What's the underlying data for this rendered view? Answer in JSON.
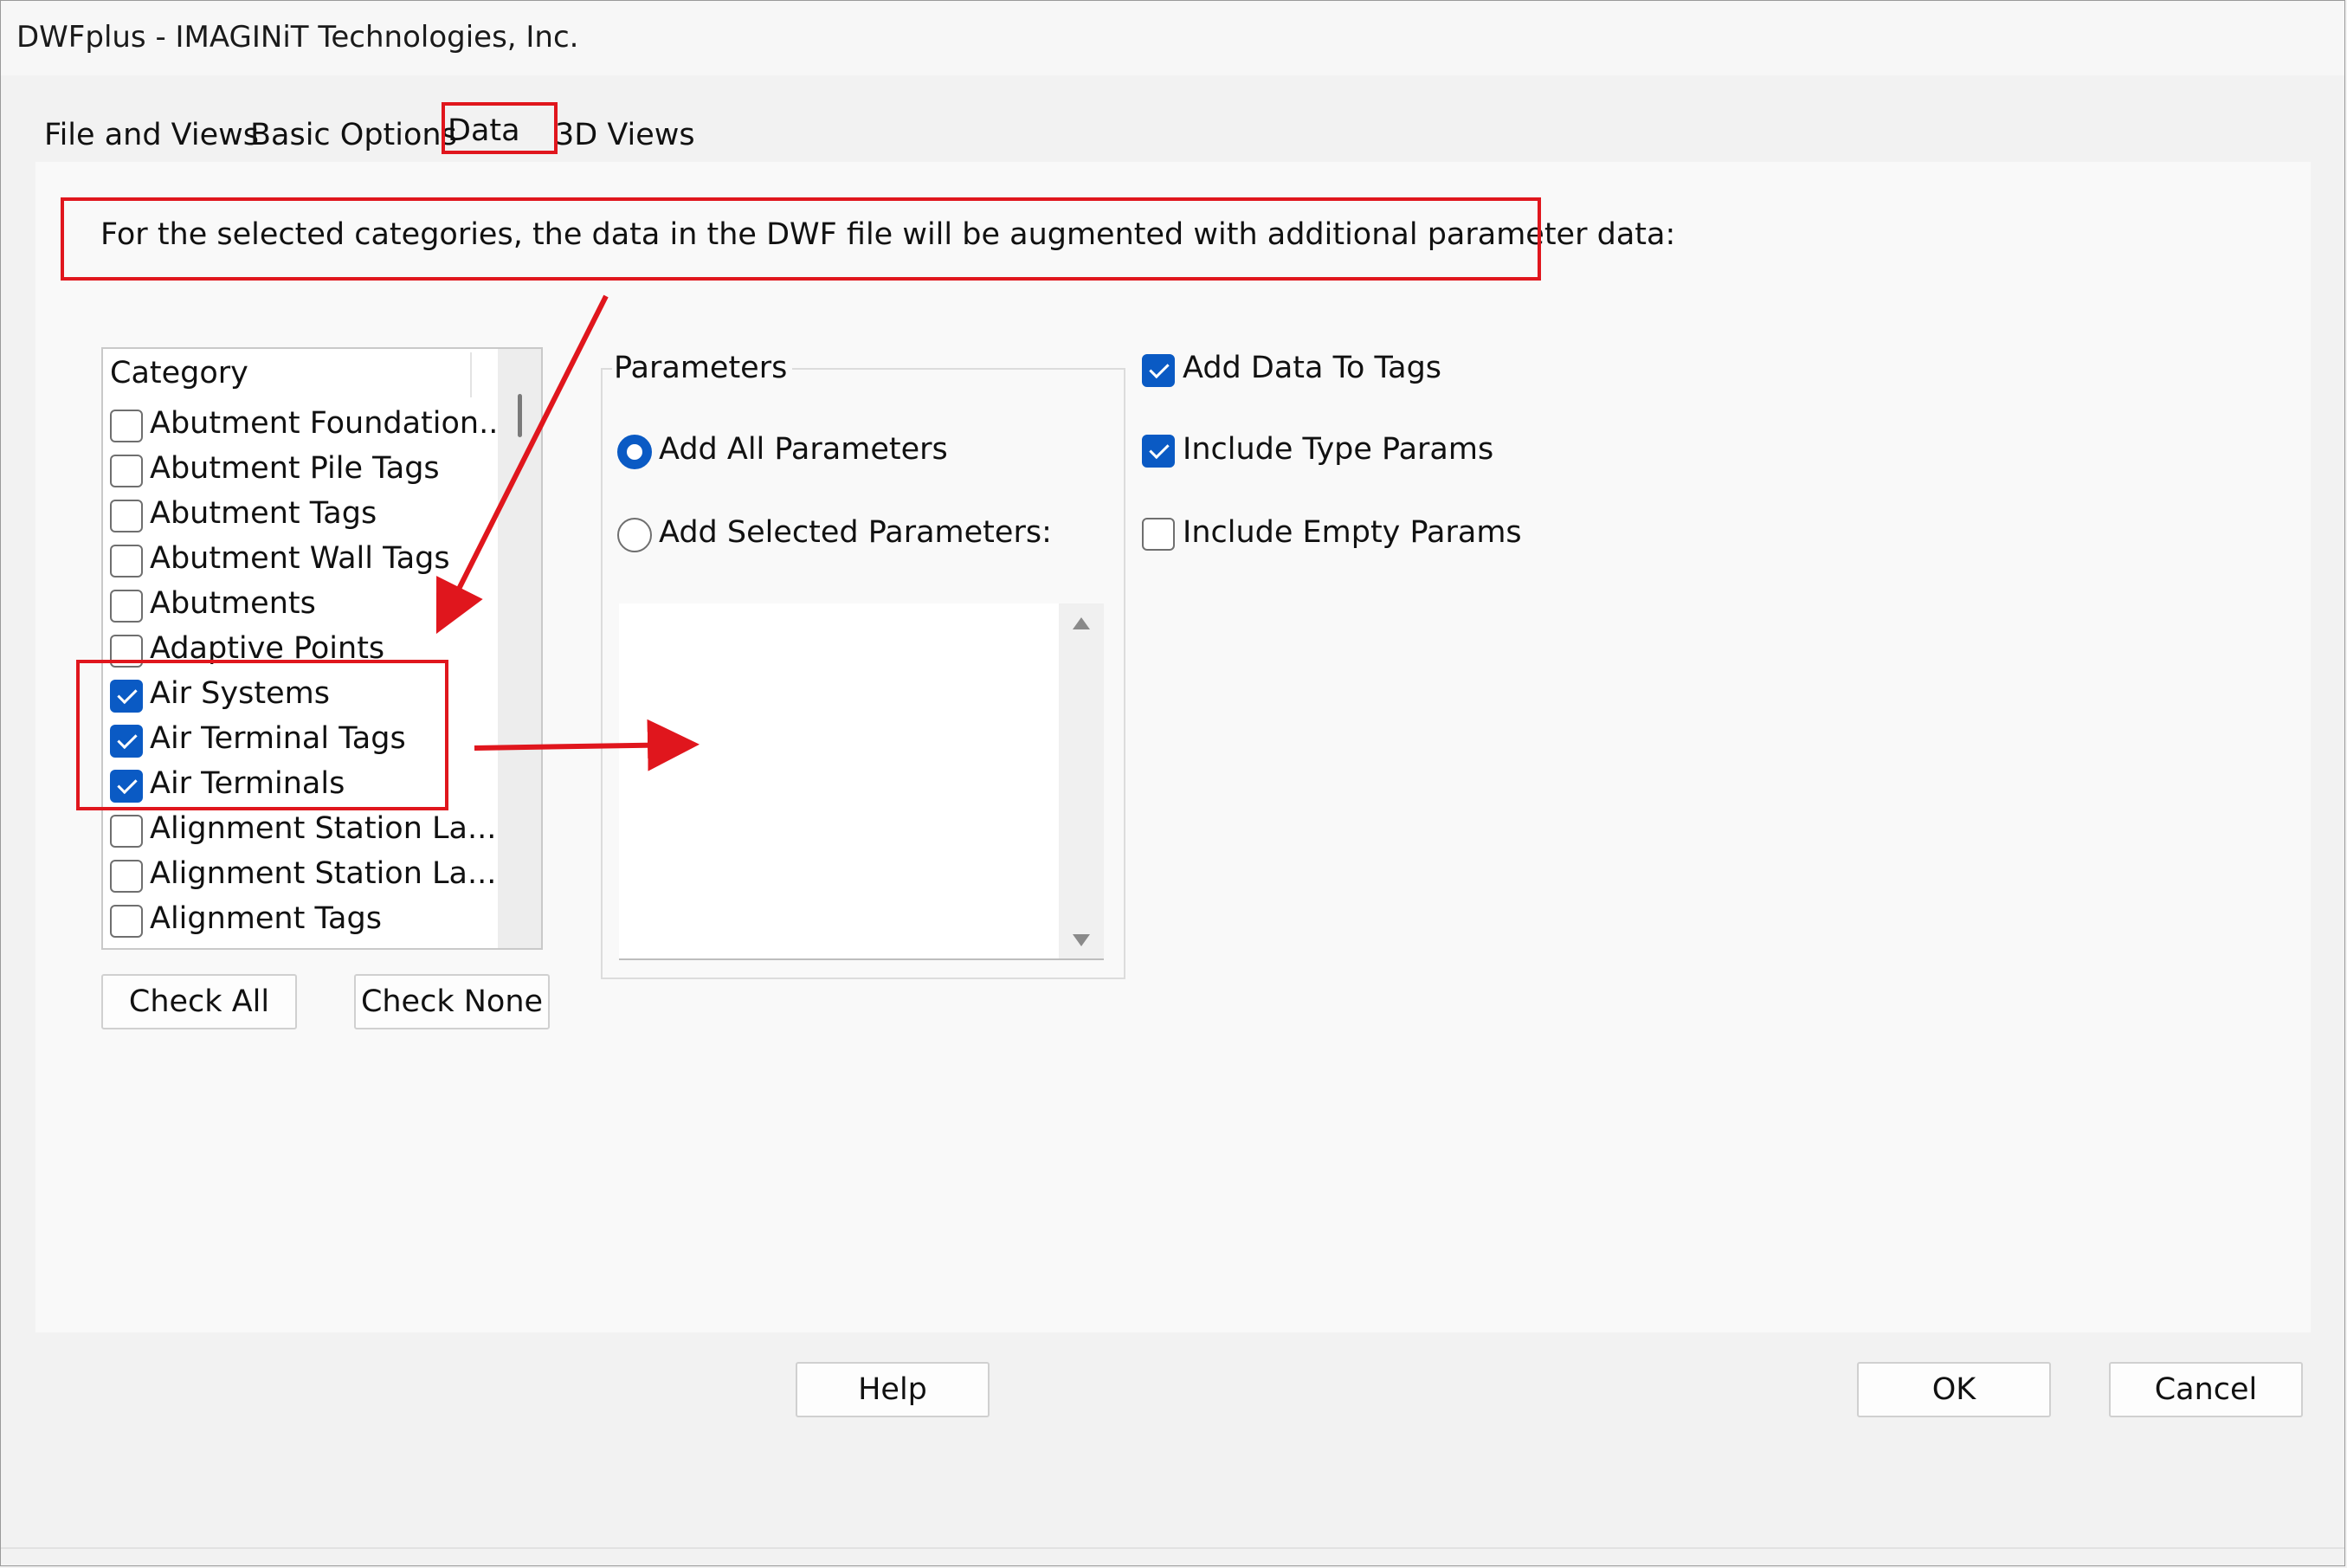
{
  "window": {
    "title": "DWFplus - IMAGINiT Technologies, Inc."
  },
  "tabs": [
    {
      "label": "File and Views"
    },
    {
      "label": "Basic Options"
    },
    {
      "label": "Data"
    },
    {
      "label": "3D Views"
    }
  ],
  "description": "For the selected categories, the data in the DWF file will be augmented with additional parameter data:",
  "category_list": {
    "header": "Category",
    "items": [
      {
        "label": "Abutment Foundation...",
        "checked": false
      },
      {
        "label": "Abutment Pile Tags",
        "checked": false
      },
      {
        "label": "Abutment Tags",
        "checked": false
      },
      {
        "label": "Abutment Wall Tags",
        "checked": false
      },
      {
        "label": "Abutments",
        "checked": false
      },
      {
        "label": "Adaptive Points",
        "checked": false
      },
      {
        "label": "Air Systems",
        "checked": true
      },
      {
        "label": "Air Terminal Tags",
        "checked": true
      },
      {
        "label": "Air Terminals",
        "checked": true
      },
      {
        "label": "Alignment Station La...",
        "checked": false
      },
      {
        "label": "Alignment Station La...",
        "checked": false
      },
      {
        "label": "Alignment Tags",
        "checked": false
      }
    ]
  },
  "buttons": {
    "check_all": "Check All",
    "check_none": "Check None",
    "help": "Help",
    "ok": "OK",
    "cancel": "Cancel"
  },
  "parameters": {
    "title": "Parameters",
    "add_all": "Add All Parameters",
    "add_selected": "Add Selected Parameters:",
    "selected_option": "add_all"
  },
  "options": {
    "add_data_to_tags": {
      "label": "Add Data To Tags",
      "checked": true
    },
    "include_type_params": {
      "label": "Include Type Params",
      "checked": true
    },
    "include_empty_params": {
      "label": "Include Empty Params",
      "checked": false
    }
  },
  "colors": {
    "accent": "#0a5ac4",
    "annotation": "#e0161d"
  }
}
